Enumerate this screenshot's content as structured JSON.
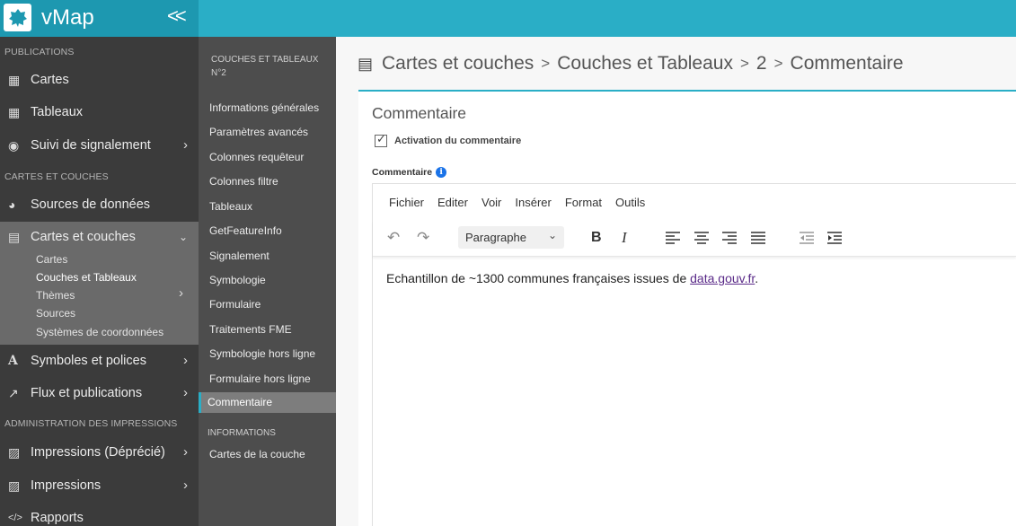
{
  "app": {
    "name": "vMap",
    "collapse_icon": "double-chevron-left-icon"
  },
  "colors": {
    "accent": "#2aaec6",
    "sidebar": "#3b3b3b",
    "midcol": "#4d4d4d"
  },
  "sidebar": {
    "sections": [
      {
        "heading": "PUBLICATIONS"
      },
      {
        "heading": "CARTES ET COUCHES"
      },
      {
        "heading": "ADMINISTRATION DES IMPRESSIONS"
      }
    ],
    "items": [
      {
        "label": "Cartes",
        "icon": "map-icon"
      },
      {
        "label": "Tableaux",
        "icon": "table-icon"
      },
      {
        "label": "Suivi de signalement",
        "icon": "eye-icon"
      },
      {
        "label": "Sources de données",
        "icon": "globe-icon"
      },
      {
        "label": "Cartes et couches",
        "icon": "book-map-icon"
      },
      {
        "label": "Symboles et polices",
        "icon": "font-icon"
      },
      {
        "label": "Flux et publications",
        "icon": "external-link-icon"
      },
      {
        "label": "Impressions (Déprécié)",
        "icon": "printer-icon"
      },
      {
        "label": "Impressions",
        "icon": "printer-icon"
      },
      {
        "label": "Rapports",
        "icon": "code-icon"
      }
    ],
    "subitems": [
      {
        "label": "Cartes"
      },
      {
        "label": "Couches et Tableaux"
      },
      {
        "label": "Thèmes"
      },
      {
        "label": "Sources"
      },
      {
        "label": "Systèmes de coordonnées"
      }
    ]
  },
  "midcol": {
    "heading": "COUCHES ET TABLEAUX N°2",
    "items": [
      "Informations générales",
      "Paramètres avancés",
      "Colonnes requêteur",
      "Colonnes filtre",
      "Tableaux",
      "GetFeatureInfo",
      "Signalement",
      "Symbologie",
      "Formulaire",
      "Traitements FME",
      "Symbologie hors ligne",
      "Formulaire hors ligne",
      "Commentaire"
    ],
    "heading2": "INFORMATIONS",
    "items2": [
      "Cartes de la couche"
    ]
  },
  "breadcrumb": {
    "parts": [
      "Cartes et couches",
      "Couches et Tableaux",
      "2",
      "Commentaire"
    ],
    "separator": ">"
  },
  "card": {
    "title": "Commentaire",
    "checkbox_label": "Activation du commentaire",
    "checkbox_checked": true,
    "field_label": "Commentaire"
  },
  "editor": {
    "menu": [
      "Fichier",
      "Editer",
      "Voir",
      "Insérer",
      "Format",
      "Outils"
    ],
    "block_format": "Paragraphe",
    "content_text": "Echantillon de ~1300 communes françaises issues de ",
    "content_link": "data.gouv.fr",
    "content_end": "."
  }
}
